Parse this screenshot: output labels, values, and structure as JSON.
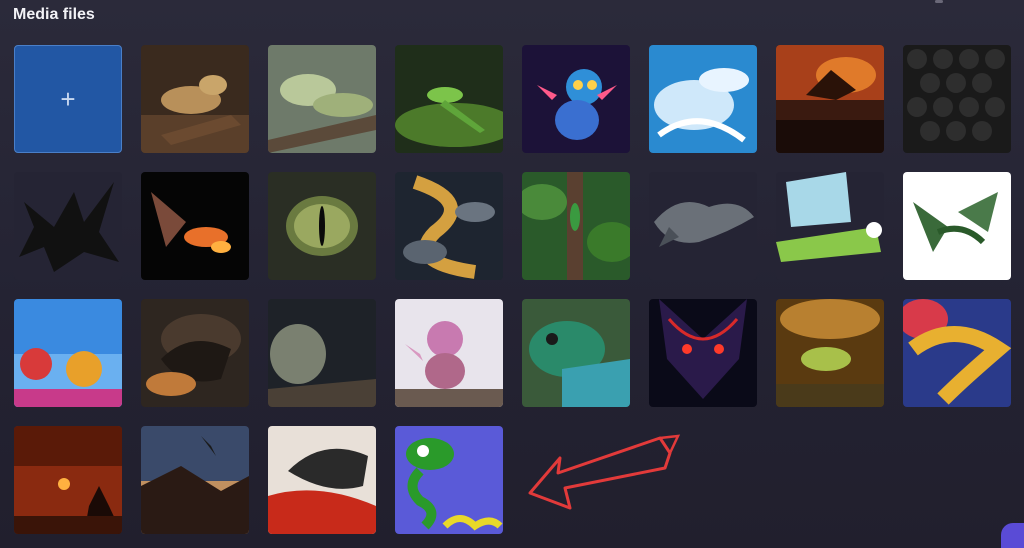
{
  "header": {
    "title": "Media files"
  },
  "add_tile": {
    "symbol": "+"
  },
  "tiles": [
    {
      "icon": "bearded-dragon"
    },
    {
      "icon": "iguana-green"
    },
    {
      "icon": "green-lizard-leaf"
    },
    {
      "icon": "cute-blue-dragon"
    },
    {
      "icon": "ice-dragon"
    },
    {
      "icon": "fire-dragon-city"
    },
    {
      "icon": "dragon-scales"
    },
    {
      "icon": "dragon-silhouette"
    },
    {
      "icon": "fire-breathing-dragon"
    },
    {
      "icon": "dragon-eye"
    },
    {
      "icon": "golden-dragon-clouds"
    },
    {
      "icon": "lizard-tree-trunk"
    },
    {
      "icon": "grey-dragon-cutout"
    },
    {
      "icon": "cartoon-dragon-green"
    },
    {
      "icon": "green-flying-dragon"
    },
    {
      "icon": "dragon-dance-festival"
    },
    {
      "icon": "dark-dragon-smoke"
    },
    {
      "icon": "grey-iguana"
    },
    {
      "icon": "pink-baby-dragon"
    },
    {
      "icon": "lizard-closeup"
    },
    {
      "icon": "red-eyed-dragon"
    },
    {
      "icon": "lizard-sunset"
    },
    {
      "icon": "gold-chinese-dragon"
    },
    {
      "icon": "dragon-sunset-silhouette"
    },
    {
      "icon": "dragon-flying-mountains"
    },
    {
      "icon": "dragon-painting-red"
    },
    {
      "icon": "cartoon-serpent-dragon"
    }
  ],
  "annotation": {
    "color": "#e23a3a",
    "icon": "arrow-pointing-left"
  },
  "colors": {
    "accent": "#5a4bd6",
    "add_tile": "#2257a4"
  }
}
